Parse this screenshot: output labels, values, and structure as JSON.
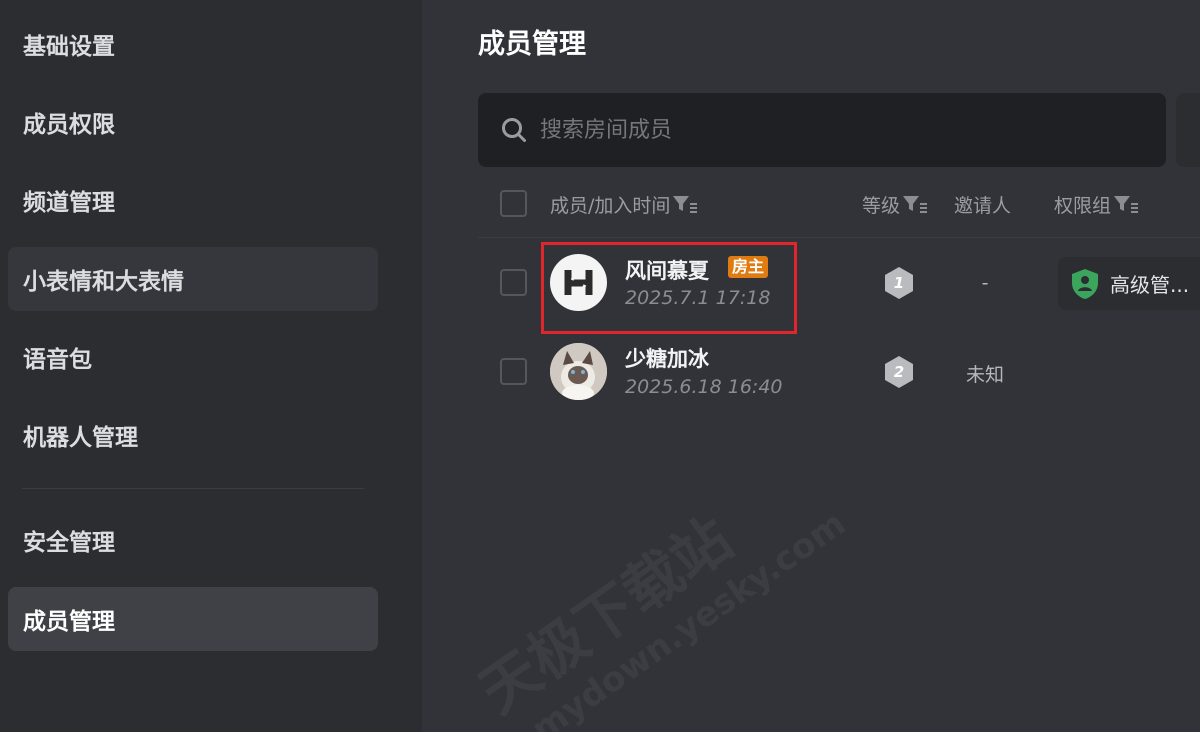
{
  "sidebar": {
    "items": [
      {
        "label": "基础设置"
      },
      {
        "label": "成员权限"
      },
      {
        "label": "频道管理"
      },
      {
        "label": "小表情和大表情"
      },
      {
        "label": "语音包"
      },
      {
        "label": "机器人管理"
      },
      {
        "label": "安全管理"
      },
      {
        "label": "成员管理"
      }
    ],
    "active": "成员管理"
  },
  "main": {
    "title": "成员管理",
    "search": {
      "placeholder": "搜索房间成员",
      "value": ""
    },
    "table": {
      "columns": {
        "member": "成员/加入时间",
        "level": "等级",
        "inviter": "邀请人",
        "role": "权限组"
      },
      "rows": [
        {
          "name": "风间慕夏",
          "badge": "房主",
          "time": "2025.7.1 17:18",
          "level": "1",
          "inviter": "-",
          "role": "高级管..."
        },
        {
          "name": "少糖加冰",
          "badge": "",
          "time": "2025.6.18 16:40",
          "level": "2",
          "inviter": "未知",
          "role": ""
        }
      ]
    }
  },
  "watermark": {
    "line1": "天极下载站",
    "line2": "mydown.yesky.com"
  },
  "icons": {
    "search": "search-icon",
    "filter": "filter-icon",
    "role": "shield-user-icon",
    "level": "hexagon-level-icon"
  },
  "colors": {
    "badge": "#e07b12",
    "role_icon": "#3ba55d",
    "highlight": "#e0262b",
    "level_hex": "#b9bbbe"
  }
}
